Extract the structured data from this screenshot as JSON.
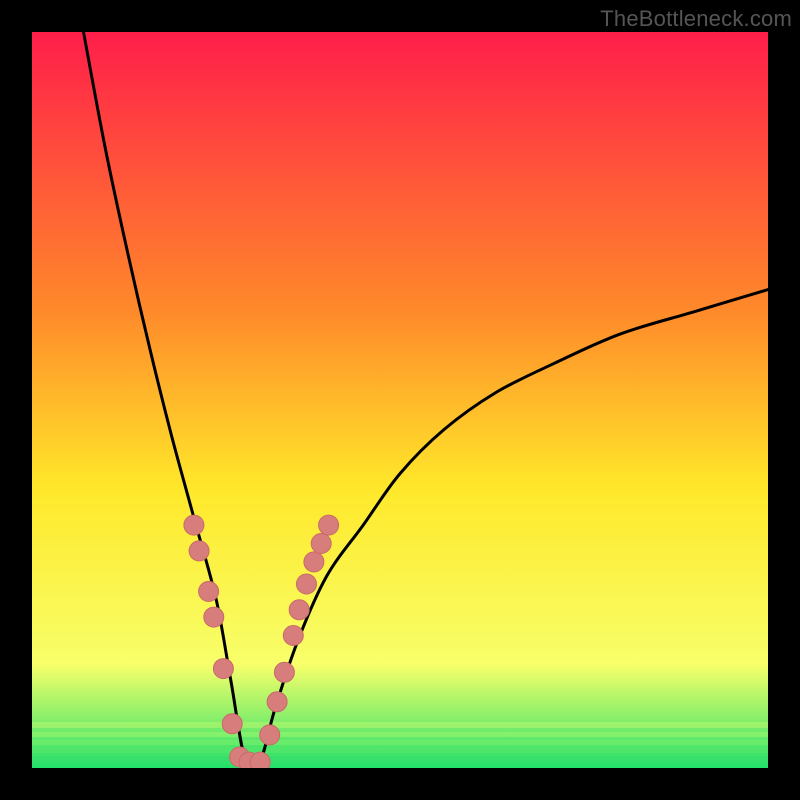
{
  "watermark": "TheBottleneck.com",
  "colors": {
    "gradient_top": "#ff1e4a",
    "gradient_mid1": "#ff8a2a",
    "gradient_mid2": "#ffe82a",
    "gradient_mid3": "#f7ff6a",
    "gradient_bottom": "#22e06a",
    "curve": "#000000",
    "marker_fill": "#d77d7c",
    "marker_stroke": "#c86a69",
    "frame_bg": "#000000"
  },
  "chart_data": {
    "type": "line",
    "title": "",
    "xlabel": "",
    "ylabel": "",
    "xlim": [
      0,
      100
    ],
    "ylim": [
      0,
      100
    ],
    "note": "Bottleneck-style V curve: minimum near x≈29 at y≈0; left branch rises steeply to y≈100 at x≈7; right branch rises to y≈65 at x≈100. Axis ticks/labels not shown; values are read from geometry.",
    "series": [
      {
        "name": "bottleneck-curve",
        "x": [
          7,
          10,
          13,
          16,
          19,
          22,
          25,
          27,
          29,
          31,
          33,
          36,
          40,
          45,
          50,
          56,
          63,
          71,
          80,
          90,
          100
        ],
        "y": [
          100,
          84,
          70,
          57,
          45,
          34,
          23,
          12,
          1,
          1,
          8,
          17,
          26,
          33,
          40,
          46,
          51,
          55,
          59,
          62,
          65
        ]
      }
    ],
    "markers": {
      "name": "highlighted-points",
      "x": [
        22.0,
        22.7,
        24.0,
        24.7,
        26.0,
        27.2,
        28.2,
        29.5,
        31.0,
        32.3,
        33.3,
        34.3,
        35.5,
        36.3,
        37.3,
        38.3,
        39.3,
        40.3
      ],
      "y": [
        33.0,
        29.5,
        24.0,
        20.5,
        13.5,
        6.0,
        1.5,
        0.8,
        0.8,
        4.5,
        9.0,
        13.0,
        18.0,
        21.5,
        25.0,
        28.0,
        30.5,
        33.0
      ]
    }
  }
}
